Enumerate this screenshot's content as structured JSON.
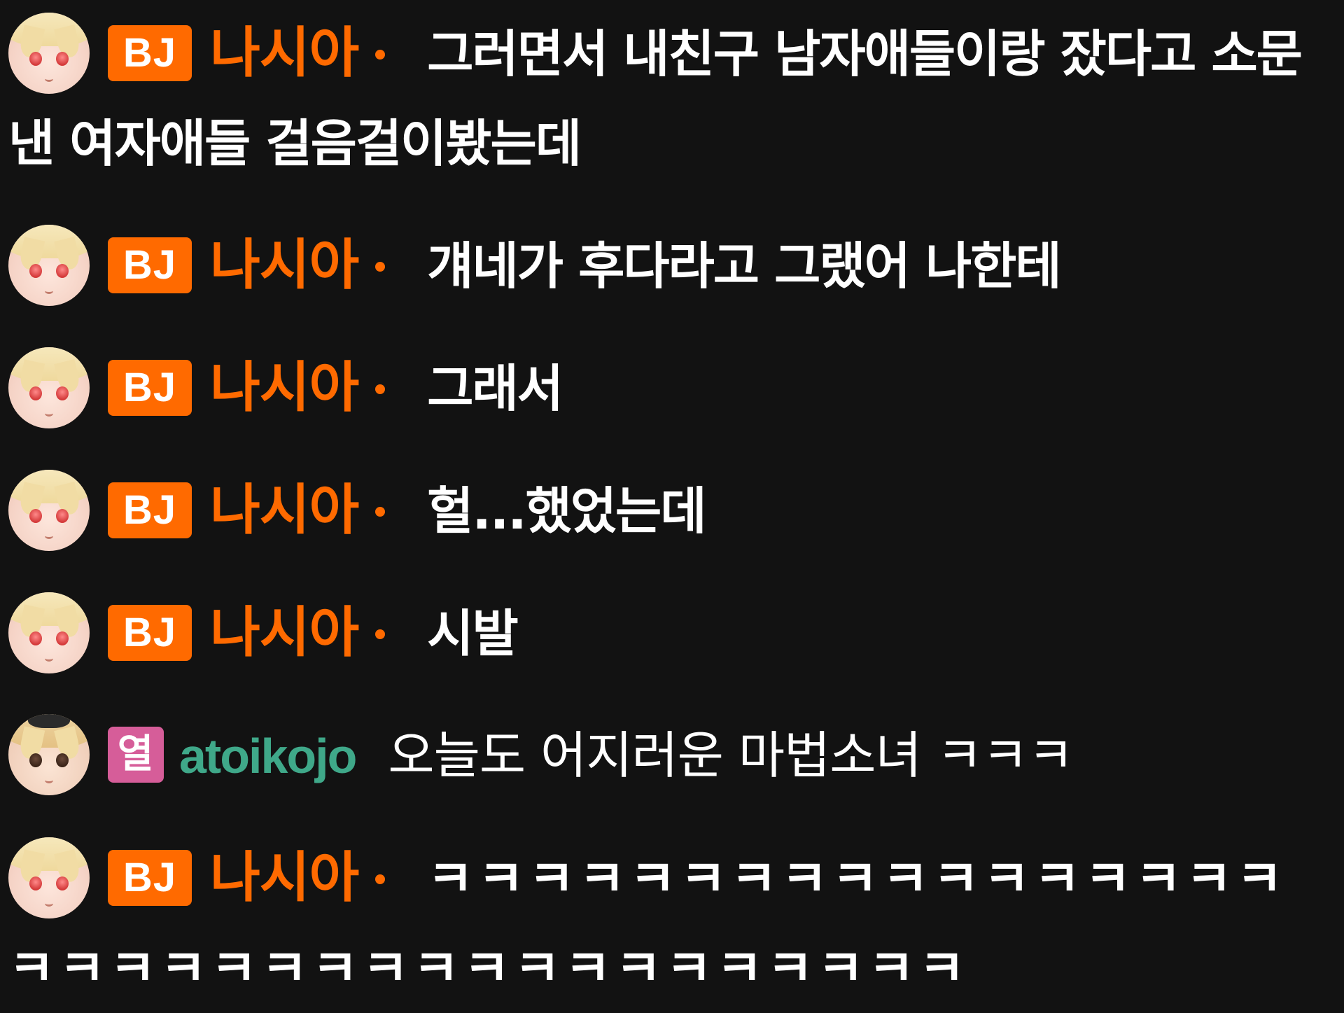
{
  "chat": {
    "messages": [
      {
        "badge": "BJ",
        "nickname": "나시아",
        "text": "그러면서 내친구 남자애들이랑 잤다고 소문낸 여자애들 걸음걸이봤는데"
      },
      {
        "badge": "BJ",
        "nickname": "나시아",
        "text": "걔네가 후다라고 그랬어 나한테"
      },
      {
        "badge": "BJ",
        "nickname": "나시아",
        "text": "그래서"
      },
      {
        "badge": "BJ",
        "nickname": "나시아",
        "text": "헐...했었는데"
      },
      {
        "badge": "BJ",
        "nickname": "나시아",
        "text": "시발"
      },
      {
        "badge": "열",
        "nickname": "atoikojo",
        "text": "오늘도 어지러운 마법소녀 ㅋㅋㅋ"
      },
      {
        "badge": "BJ",
        "nickname": "나시아",
        "text": "ㅋㅋㅋㅋㅋㅋㅋㅋㅋㅋㅋㅋㅋㅋㅋㅋㅋㅋㅋㅋㅋㅋㅋㅋㅋㅋㅋㅋㅋㅋㅋㅋㅋㅋㅋㅋ"
      }
    ]
  },
  "colors": {
    "background": "#121212",
    "bj_badge": "#ff6a00",
    "bj_nickname": "#ff6a00",
    "fan_badge": "#d65d99",
    "fan_nickname": "#3fa889",
    "message_text": "#ffffff"
  },
  "icons": {
    "bj_avatar": "streamer-avatar-icon",
    "fan_avatar": "viewer-avatar-icon",
    "status_dot": "dot-icon"
  }
}
